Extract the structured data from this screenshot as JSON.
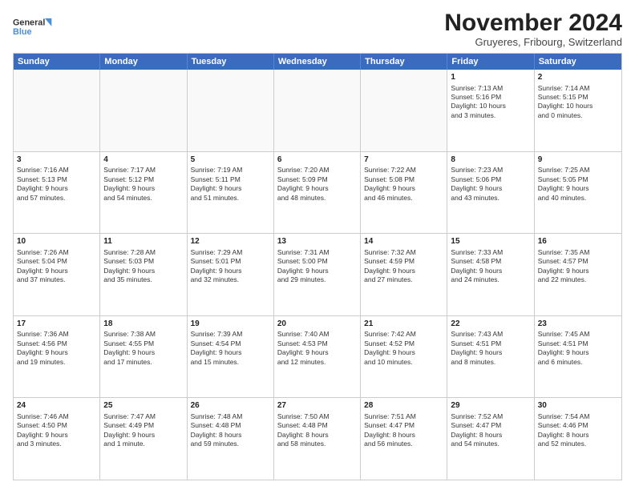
{
  "header": {
    "logo_general": "General",
    "logo_blue": "Blue",
    "month_title": "November 2024",
    "subtitle": "Gruyeres, Fribourg, Switzerland"
  },
  "days_of_week": [
    "Sunday",
    "Monday",
    "Tuesday",
    "Wednesday",
    "Thursday",
    "Friday",
    "Saturday"
  ],
  "rows": [
    [
      {
        "day": "",
        "lines": []
      },
      {
        "day": "",
        "lines": []
      },
      {
        "day": "",
        "lines": []
      },
      {
        "day": "",
        "lines": []
      },
      {
        "day": "",
        "lines": []
      },
      {
        "day": "1",
        "lines": [
          "Sunrise: 7:13 AM",
          "Sunset: 5:16 PM",
          "Daylight: 10 hours",
          "and 3 minutes."
        ]
      },
      {
        "day": "2",
        "lines": [
          "Sunrise: 7:14 AM",
          "Sunset: 5:15 PM",
          "Daylight: 10 hours",
          "and 0 minutes."
        ]
      }
    ],
    [
      {
        "day": "3",
        "lines": [
          "Sunrise: 7:16 AM",
          "Sunset: 5:13 PM",
          "Daylight: 9 hours",
          "and 57 minutes."
        ]
      },
      {
        "day": "4",
        "lines": [
          "Sunrise: 7:17 AM",
          "Sunset: 5:12 PM",
          "Daylight: 9 hours",
          "and 54 minutes."
        ]
      },
      {
        "day": "5",
        "lines": [
          "Sunrise: 7:19 AM",
          "Sunset: 5:11 PM",
          "Daylight: 9 hours",
          "and 51 minutes."
        ]
      },
      {
        "day": "6",
        "lines": [
          "Sunrise: 7:20 AM",
          "Sunset: 5:09 PM",
          "Daylight: 9 hours",
          "and 48 minutes."
        ]
      },
      {
        "day": "7",
        "lines": [
          "Sunrise: 7:22 AM",
          "Sunset: 5:08 PM",
          "Daylight: 9 hours",
          "and 46 minutes."
        ]
      },
      {
        "day": "8",
        "lines": [
          "Sunrise: 7:23 AM",
          "Sunset: 5:06 PM",
          "Daylight: 9 hours",
          "and 43 minutes."
        ]
      },
      {
        "day": "9",
        "lines": [
          "Sunrise: 7:25 AM",
          "Sunset: 5:05 PM",
          "Daylight: 9 hours",
          "and 40 minutes."
        ]
      }
    ],
    [
      {
        "day": "10",
        "lines": [
          "Sunrise: 7:26 AM",
          "Sunset: 5:04 PM",
          "Daylight: 9 hours",
          "and 37 minutes."
        ]
      },
      {
        "day": "11",
        "lines": [
          "Sunrise: 7:28 AM",
          "Sunset: 5:03 PM",
          "Daylight: 9 hours",
          "and 35 minutes."
        ]
      },
      {
        "day": "12",
        "lines": [
          "Sunrise: 7:29 AM",
          "Sunset: 5:01 PM",
          "Daylight: 9 hours",
          "and 32 minutes."
        ]
      },
      {
        "day": "13",
        "lines": [
          "Sunrise: 7:31 AM",
          "Sunset: 5:00 PM",
          "Daylight: 9 hours",
          "and 29 minutes."
        ]
      },
      {
        "day": "14",
        "lines": [
          "Sunrise: 7:32 AM",
          "Sunset: 4:59 PM",
          "Daylight: 9 hours",
          "and 27 minutes."
        ]
      },
      {
        "day": "15",
        "lines": [
          "Sunrise: 7:33 AM",
          "Sunset: 4:58 PM",
          "Daylight: 9 hours",
          "and 24 minutes."
        ]
      },
      {
        "day": "16",
        "lines": [
          "Sunrise: 7:35 AM",
          "Sunset: 4:57 PM",
          "Daylight: 9 hours",
          "and 22 minutes."
        ]
      }
    ],
    [
      {
        "day": "17",
        "lines": [
          "Sunrise: 7:36 AM",
          "Sunset: 4:56 PM",
          "Daylight: 9 hours",
          "and 19 minutes."
        ]
      },
      {
        "day": "18",
        "lines": [
          "Sunrise: 7:38 AM",
          "Sunset: 4:55 PM",
          "Daylight: 9 hours",
          "and 17 minutes."
        ]
      },
      {
        "day": "19",
        "lines": [
          "Sunrise: 7:39 AM",
          "Sunset: 4:54 PM",
          "Daylight: 9 hours",
          "and 15 minutes."
        ]
      },
      {
        "day": "20",
        "lines": [
          "Sunrise: 7:40 AM",
          "Sunset: 4:53 PM",
          "Daylight: 9 hours",
          "and 12 minutes."
        ]
      },
      {
        "day": "21",
        "lines": [
          "Sunrise: 7:42 AM",
          "Sunset: 4:52 PM",
          "Daylight: 9 hours",
          "and 10 minutes."
        ]
      },
      {
        "day": "22",
        "lines": [
          "Sunrise: 7:43 AM",
          "Sunset: 4:51 PM",
          "Daylight: 9 hours",
          "and 8 minutes."
        ]
      },
      {
        "day": "23",
        "lines": [
          "Sunrise: 7:45 AM",
          "Sunset: 4:51 PM",
          "Daylight: 9 hours",
          "and 6 minutes."
        ]
      }
    ],
    [
      {
        "day": "24",
        "lines": [
          "Sunrise: 7:46 AM",
          "Sunset: 4:50 PM",
          "Daylight: 9 hours",
          "and 3 minutes."
        ]
      },
      {
        "day": "25",
        "lines": [
          "Sunrise: 7:47 AM",
          "Sunset: 4:49 PM",
          "Daylight: 9 hours",
          "and 1 minute."
        ]
      },
      {
        "day": "26",
        "lines": [
          "Sunrise: 7:48 AM",
          "Sunset: 4:48 PM",
          "Daylight: 8 hours",
          "and 59 minutes."
        ]
      },
      {
        "day": "27",
        "lines": [
          "Sunrise: 7:50 AM",
          "Sunset: 4:48 PM",
          "Daylight: 8 hours",
          "and 58 minutes."
        ]
      },
      {
        "day": "28",
        "lines": [
          "Sunrise: 7:51 AM",
          "Sunset: 4:47 PM",
          "Daylight: 8 hours",
          "and 56 minutes."
        ]
      },
      {
        "day": "29",
        "lines": [
          "Sunrise: 7:52 AM",
          "Sunset: 4:47 PM",
          "Daylight: 8 hours",
          "and 54 minutes."
        ]
      },
      {
        "day": "30",
        "lines": [
          "Sunrise: 7:54 AM",
          "Sunset: 4:46 PM",
          "Daylight: 8 hours",
          "and 52 minutes."
        ]
      }
    ]
  ]
}
